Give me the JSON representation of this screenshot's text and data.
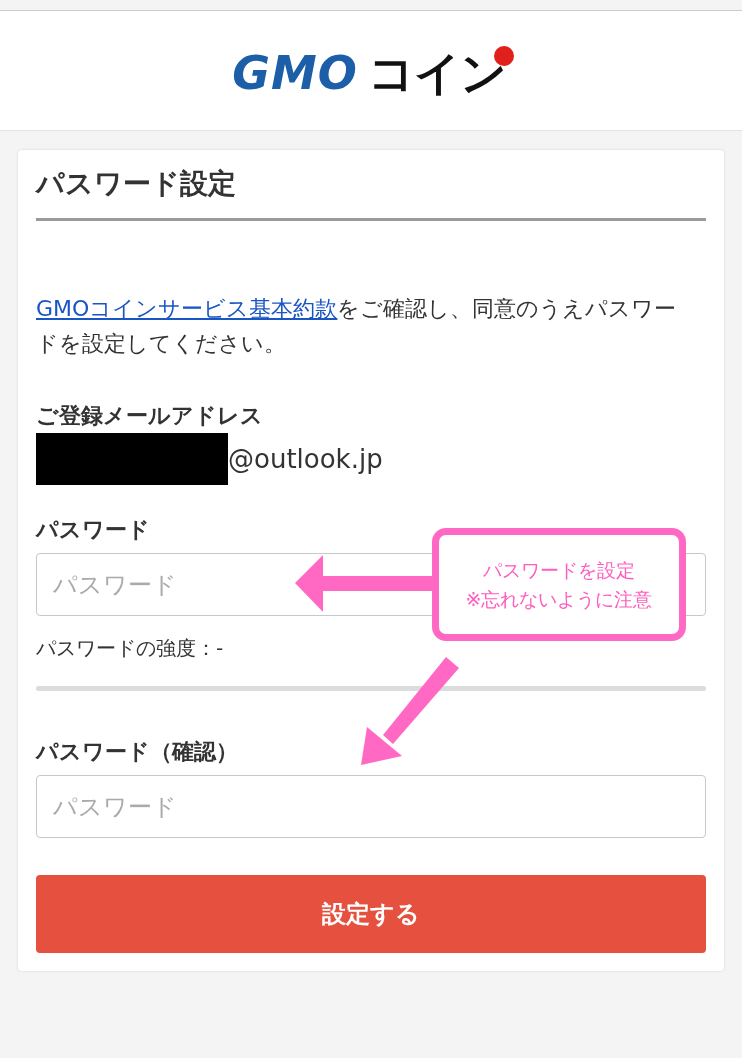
{
  "header": {
    "logo": {
      "brand": "GMO",
      "product": "コイン"
    }
  },
  "card": {
    "title": "パスワード設定",
    "intro": {
      "link": "GMOコインサービス基本約款",
      "text": "をご確認し、同意のうえパスワードを設定してください。"
    },
    "email": {
      "label": "ご登録メールアドレス",
      "redacted": true,
      "domain": "@outlook.jp"
    },
    "password_field": {
      "label": "パスワード",
      "placeholder": "パスワード"
    },
    "strength": {
      "label": "パスワードの強度：-",
      "level": 0
    },
    "confirm_field": {
      "label": "パスワード（確認）",
      "placeholder": "パスワード"
    },
    "submit": "設定する"
  },
  "annotation": {
    "lines": [
      "パスワードを設定",
      "※忘れないように注意"
    ]
  }
}
